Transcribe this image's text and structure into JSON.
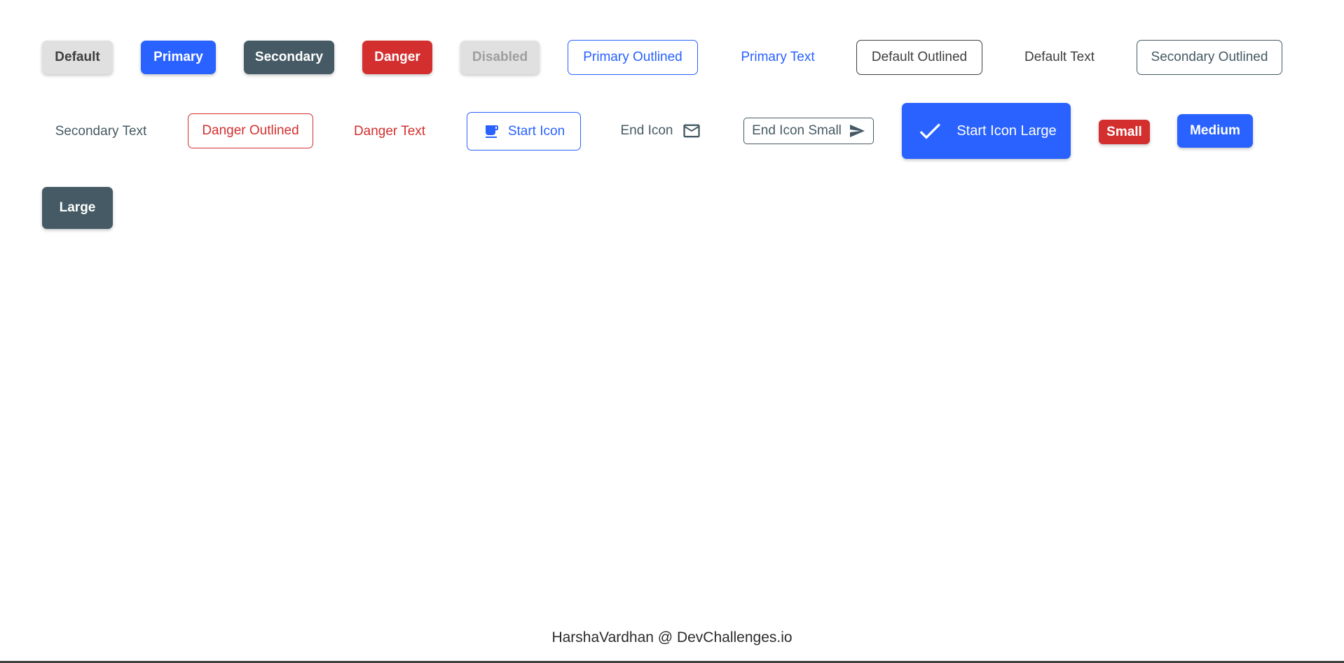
{
  "buttons": {
    "default": "Default",
    "primary": "Primary",
    "secondary": "Secondary",
    "danger": "Danger",
    "disabled": "Disabled",
    "primary_outlined": "Primary Outlined",
    "primary_text": "Primary Text",
    "default_outlined": "Default Outlined",
    "default_text": "Default Text",
    "secondary_outlined": "Secondary Outlined",
    "secondary_text": "Secondary Text",
    "danger_outlined": "Danger Outlined",
    "danger_text": "Danger Text",
    "start_icon": "Start Icon",
    "end_icon": "End Icon",
    "end_icon_small": "End Icon Small",
    "start_icon_large": "Start Icon Large",
    "small": "Small",
    "medium": "Medium",
    "large": "Large"
  },
  "icons": {
    "start_icon": "coffee-cup-icon",
    "end_icon": "mail-icon",
    "end_icon_small": "send-icon",
    "start_icon_large": "check-icon"
  },
  "footer": {
    "credit": "HarshaVardhan @ DevChallenges.io"
  },
  "colors": {
    "default_bg": "#E0E0E0",
    "default_text": "#3F3F3F",
    "primary": "#2962FF",
    "secondary": "#455A64",
    "danger": "#D32F2F",
    "disabled_text": "#9E9E9E",
    "background": "#FFFFFF"
  }
}
